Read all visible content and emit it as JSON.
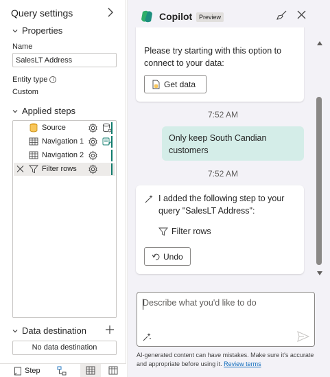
{
  "query_settings": {
    "title": "Query settings",
    "properties": {
      "header": "Properties",
      "name_label": "Name",
      "name_value": "SalesLT Address",
      "entity_type_label": "Entity type",
      "entity_type_value": "Custom"
    },
    "applied_steps": {
      "header": "Applied steps",
      "steps": [
        {
          "label": "Source",
          "icon": "database-icon"
        },
        {
          "label": "Navigation 1",
          "icon": "table-icon"
        },
        {
          "label": "Navigation 2",
          "icon": "table-icon"
        },
        {
          "label": "Filter rows",
          "icon": "filter-icon",
          "selected": true
        }
      ]
    },
    "data_destination": {
      "header": "Data destination",
      "value": "No data destination"
    }
  },
  "bottom_bar": {
    "step_label": "Step"
  },
  "copilot": {
    "title": "Copilot",
    "badge": "Preview",
    "messages": {
      "assistant1_text": "Please try starting with this option to connect to your data:",
      "get_data_label": "Get data",
      "time1": "7:52 AM",
      "user_text": "Only keep South Candian customers",
      "time2": "7:52 AM",
      "assistant2_text": "I added the following step to your query \"SalesLT Address\":",
      "step_ref_label": "Filter rows",
      "undo_label": "Undo"
    },
    "input_placeholder": "Describe what you'd like to do",
    "disclaimer_text": "AI-generated content can have mistakes. Make sure it's accurate and appropriate before using it.",
    "review_terms_label": "Review terms"
  },
  "colors": {
    "accent_teal": "#0f7b6c",
    "user_bubble": "#d4ede8",
    "panel_bg": "#f3f2f7",
    "link": "#0f6cbd"
  }
}
